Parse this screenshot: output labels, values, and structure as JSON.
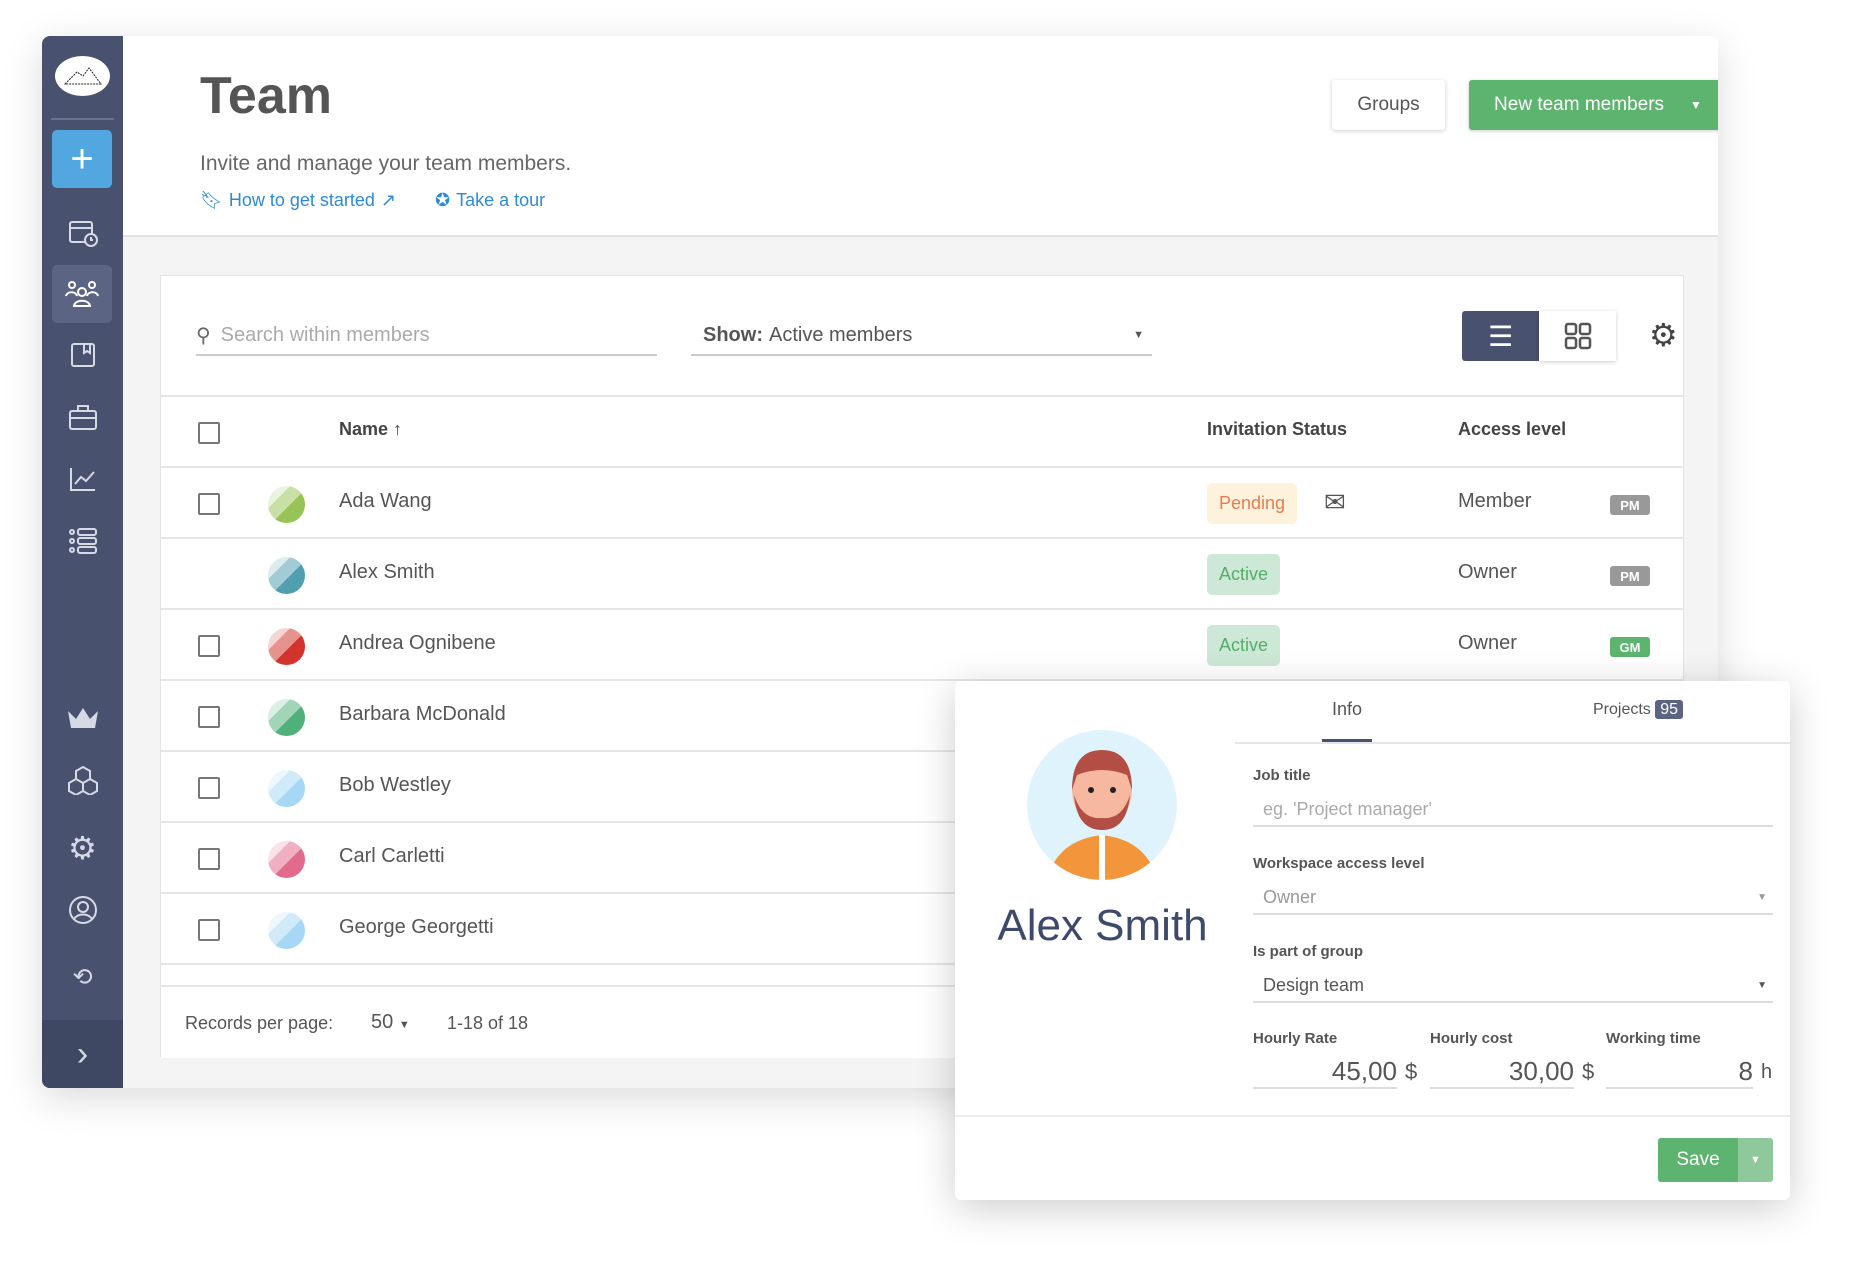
{
  "sidebar": {
    "items": [
      "add",
      "calendar",
      "team",
      "book",
      "briefcase",
      "reports",
      "list",
      "crown",
      "integrations",
      "settings",
      "profile",
      "history",
      "expand"
    ],
    "active": "team",
    "accent": "#52a7e0",
    "bg": "#48516e"
  },
  "header": {
    "title": "Team",
    "subtitle": "Invite and manage your team members.",
    "link_started": "How to get started",
    "link_tour": "Take a tour",
    "groups_label": "Groups",
    "new_members_label": "New team members"
  },
  "toolbar": {
    "search_placeholder": "Search within members",
    "show_label": "Show:",
    "show_value": "Active members"
  },
  "table": {
    "columns": {
      "name": "Name",
      "invitation": "Invitation Status",
      "access": "Access level"
    },
    "rows": [
      {
        "name": "Ada Wang",
        "status": "Pending",
        "access": "Member",
        "badge": "PM",
        "color": "#98c457",
        "checkbox": true,
        "mail": true
      },
      {
        "name": "Alex Smith",
        "status": "Active",
        "access": "Owner",
        "badge": "PM",
        "color": "#4f9fb0",
        "checkbox": false
      },
      {
        "name": "Andrea Ognibene",
        "status": "Active",
        "access": "Owner",
        "badge": "GM",
        "color": "#d0342c",
        "checkbox": true
      },
      {
        "name": "Barbara McDonald",
        "color": "#4fb07a",
        "checkbox": true
      },
      {
        "name": "Bob Westley",
        "color": "#a6d8f5",
        "checkbox": true
      },
      {
        "name": "Carl Carletti",
        "color": "#e26b8d",
        "checkbox": true
      },
      {
        "name": "George Georgetti",
        "color": "#a6d8f5",
        "checkbox": true
      }
    ]
  },
  "footer": {
    "records_label": "Records per page:",
    "per_page": "50",
    "range": "1-18 of 18"
  },
  "modal": {
    "name": "Alex Smith",
    "tabs": {
      "info": "Info",
      "projects": "Projects",
      "projects_count": "95"
    },
    "job_title_label": "Job title",
    "job_title_placeholder": "eg. 'Project manager'",
    "access_label": "Workspace access level",
    "access_value": "Owner",
    "group_label": "Is part of group",
    "group_value": "Design team",
    "rate_label": "Hourly Rate",
    "rate_value": "45,00",
    "rate_unit": "$",
    "cost_label": "Hourly cost",
    "cost_value": "30,00",
    "cost_unit": "$",
    "time_label": "Working time",
    "time_value": "8",
    "time_unit": "h",
    "save_label": "Save"
  }
}
